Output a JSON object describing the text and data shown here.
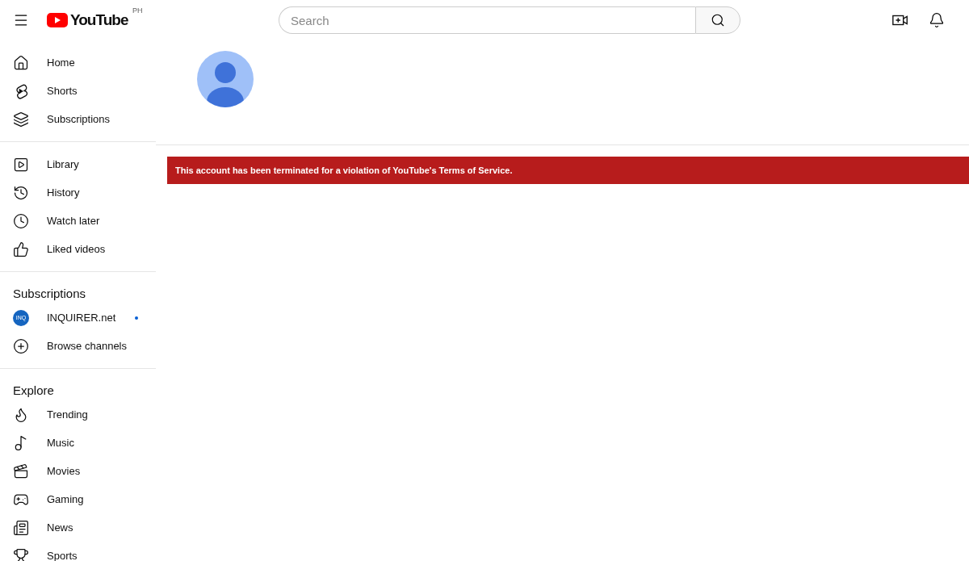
{
  "header": {
    "logo_text": "YouTube",
    "country": "PH",
    "search": {
      "placeholder": "Search"
    }
  },
  "sidebar": {
    "sections": [
      {
        "items": [
          {
            "label": "Home",
            "selected": false
          },
          {
            "label": "Shorts",
            "selected": false
          },
          {
            "label": "Subscriptions",
            "selected": false
          }
        ]
      },
      {
        "items": [
          {
            "label": "Library",
            "selected": false
          },
          {
            "label": "History",
            "selected": false
          },
          {
            "label": "Watch later",
            "selected": false
          },
          {
            "label": "Liked videos",
            "selected": false
          }
        ]
      },
      {
        "title": "Subscriptions",
        "items": [
          {
            "kind": "channel",
            "label": "INQUIRER.net",
            "avatar_text": "INQ",
            "new": true
          },
          {
            "kind": "nav",
            "label": "Browse channels",
            "selected": false
          }
        ]
      },
      {
        "title": "Explore",
        "items": [
          {
            "label": "Trending",
            "selected": false
          },
          {
            "label": "Music",
            "selected": false
          },
          {
            "label": "Movies",
            "selected": false
          },
          {
            "label": "Gaming",
            "selected": false
          },
          {
            "label": "News",
            "selected": false
          },
          {
            "label": "Sports",
            "selected": false
          }
        ]
      }
    ]
  },
  "channel": {
    "alert": "This account has been terminated for a violation of YouTube's Terms of Service."
  }
}
